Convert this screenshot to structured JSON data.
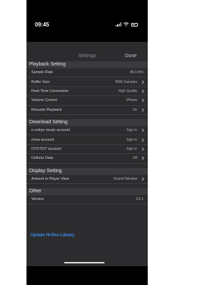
{
  "status": {
    "time": "09:45"
  },
  "nav": {
    "title": "Settings",
    "done_label": "Done"
  },
  "playback": {
    "header": "Playback Setting",
    "rows": [
      {
        "label": "Sample Rate",
        "value": "48.0 kHz"
      },
      {
        "label": "Buffer Size",
        "value": "4096 Samples"
      },
      {
        "label": "Real-Time Conversion",
        "value": "High Quality"
      },
      {
        "label": "Volume Control",
        "value": "iPhone"
      },
      {
        "label": "Resume Playback",
        "value": "On"
      }
    ]
  },
  "download": {
    "header": "Download Setting",
    "rows": [
      {
        "label": "e-onkyo music account",
        "value": "Sign In"
      },
      {
        "label": "mora account",
        "value": "Sign In"
      },
      {
        "label": "OTOTOY account",
        "value": "Sign In"
      },
      {
        "label": "Cellular Data",
        "value": "Off"
      }
    ]
  },
  "display": {
    "header": "Display Setting",
    "rows": [
      {
        "label": "Artwork in Player View",
        "value": "Round Window"
      }
    ]
  },
  "other": {
    "header": "Other",
    "rows": [
      {
        "label": "Version",
        "value": "3.5.1"
      }
    ]
  },
  "update_link": "Update Hi-Res Library"
}
